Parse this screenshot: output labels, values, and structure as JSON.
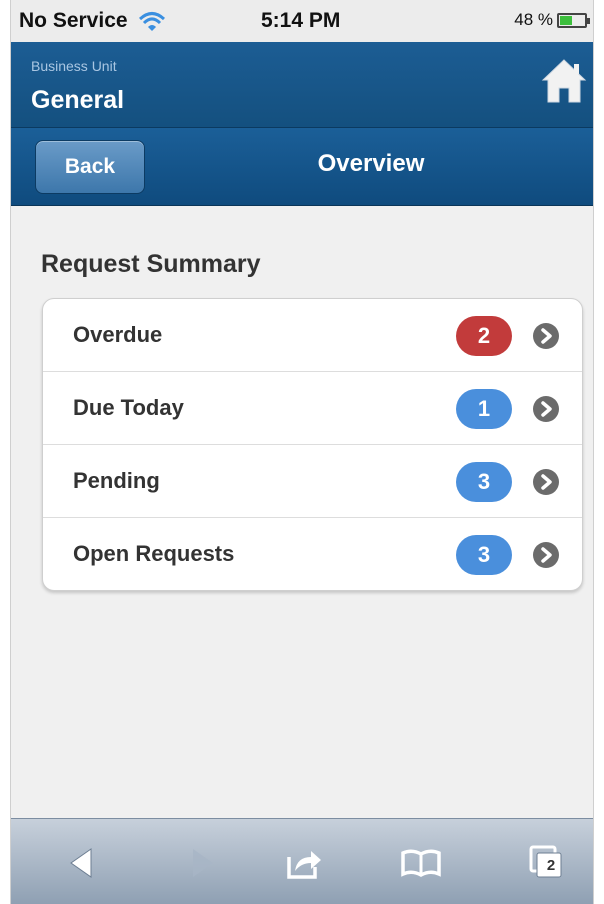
{
  "status_bar": {
    "carrier": "No Service",
    "time": "5:14 PM",
    "battery_percent": "48 %",
    "battery_level": 0.48,
    "wifi_icon": "wifi-icon",
    "battery_icon": "battery-icon"
  },
  "header": {
    "label": "Business Unit",
    "value": "General",
    "home_icon": "home-icon"
  },
  "navbar": {
    "back_label": "Back",
    "title": "Overview"
  },
  "summary": {
    "title": "Request Summary",
    "items": [
      {
        "label": "Overdue",
        "count": "2",
        "color": "#c23b3b"
      },
      {
        "label": "Due Today",
        "count": "1",
        "color": "#4a8fdc"
      },
      {
        "label": "Pending",
        "count": "3",
        "color": "#4a8fdc"
      },
      {
        "label": "Open Requests",
        "count": "3",
        "color": "#4a8fdc"
      }
    ]
  },
  "toolbar": {
    "buttons": [
      "back-arrow-icon",
      "forward-arrow-icon",
      "share-icon",
      "bookmarks-icon",
      "tabs-icon"
    ],
    "tabs_count": "2"
  }
}
